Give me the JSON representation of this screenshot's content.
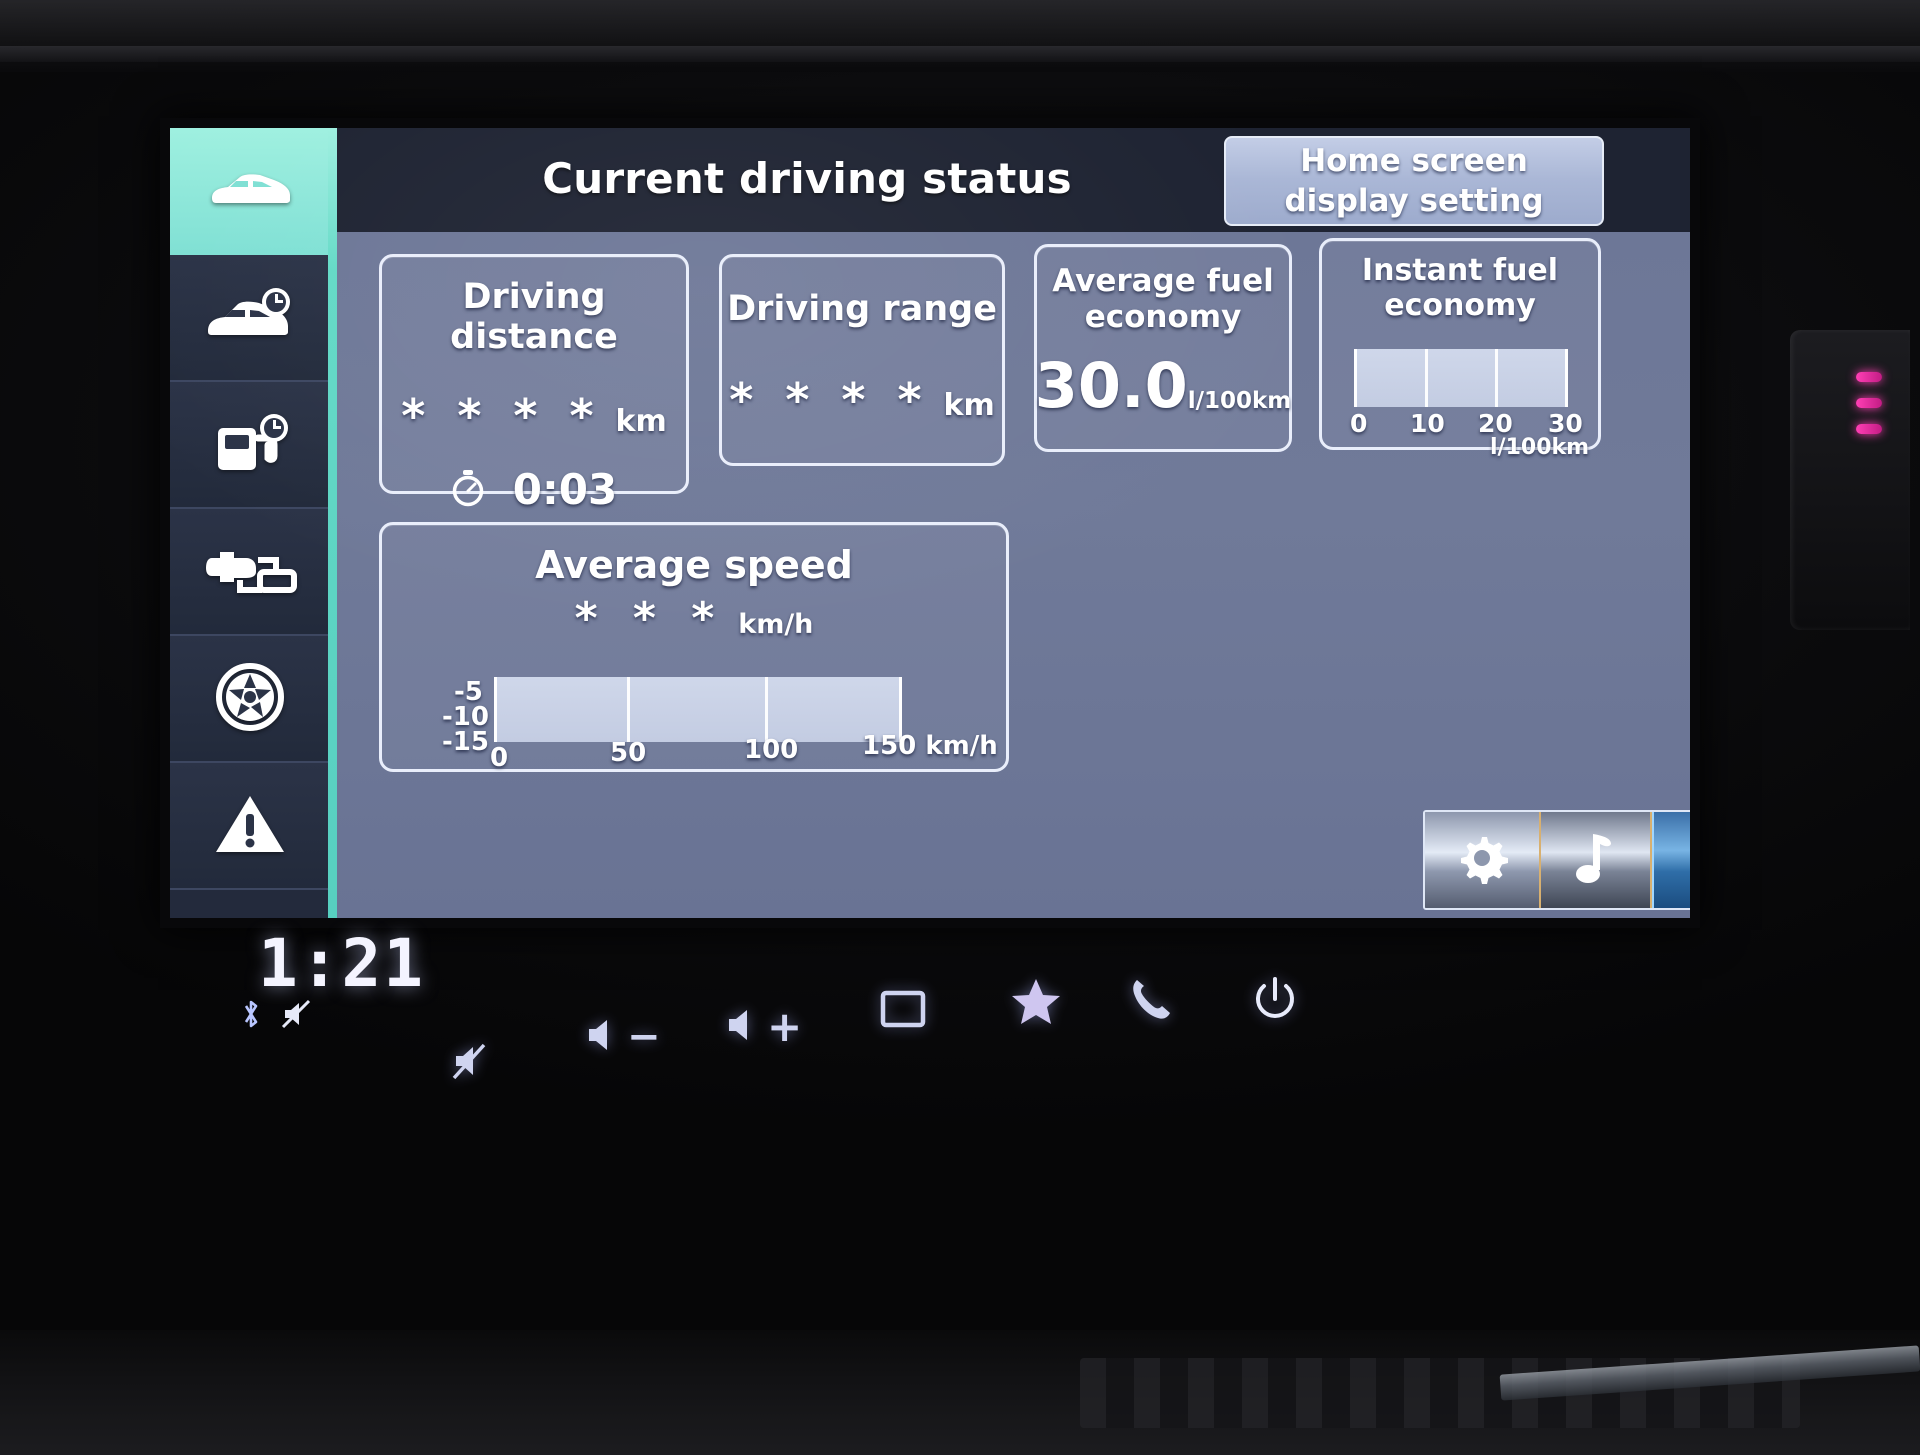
{
  "screen": {
    "header": {
      "title": "Current driving status",
      "home_button": {
        "line1": "Home screen",
        "line2": "display setting"
      }
    },
    "sidebar": [
      {
        "name": "vehicle-status",
        "icon": "car-icon",
        "active": true
      },
      {
        "name": "driving-time",
        "icon": "car-clock-icon",
        "active": false
      },
      {
        "name": "fuel-time",
        "icon": "fuel-pump-clock-icon",
        "active": false
      },
      {
        "name": "engine-system",
        "icon": "engine-network-icon",
        "active": false
      },
      {
        "name": "tyre-pressure",
        "icon": "wheel-icon",
        "active": false
      },
      {
        "name": "warnings",
        "icon": "warning-triangle-icon",
        "active": false
      }
    ],
    "cards": {
      "driving_distance": {
        "title_line1": "Driving",
        "title_line2": "distance",
        "value": "* * * *",
        "unit": "km",
        "timer_icon": "stopwatch-icon",
        "timer_value": "0:03"
      },
      "driving_range": {
        "title": "Driving range",
        "value": "* * * *",
        "unit": "km"
      },
      "average_fuel_economy": {
        "title_line1": "Average fuel",
        "title_line2": "economy",
        "value": "30.0",
        "unit": "l/100km"
      },
      "instant_fuel_economy": {
        "title_line1": "Instant fuel",
        "title_line2": "economy",
        "unit": "l/100km",
        "ticks": [
          "0",
          "10",
          "20",
          "30"
        ],
        "bar_fill_percent": 0
      },
      "average_speed": {
        "title": "Average speed",
        "value": "* * *",
        "unit": "km/h",
        "y_ticks": [
          "-5",
          "-10",
          "-15"
        ],
        "x_ticks": [
          "0",
          "50",
          "100"
        ],
        "x_last_tick": "150 km/h",
        "bar_fill_percent": 0
      }
    },
    "shortcut_bar": [
      {
        "name": "settings",
        "icon": "gear-icon",
        "selected": false
      },
      {
        "name": "media",
        "icon": "music-note-icon",
        "selected": false
      },
      {
        "name": "navigation",
        "icon": "navigation-arrow-icon",
        "selected": true
      }
    ]
  },
  "status_strip": {
    "clock": "1:21",
    "icons": [
      {
        "name": "bluetooth",
        "icon": "bluetooth-icon"
      },
      {
        "name": "mute",
        "icon": "speaker-mute-icon"
      }
    ]
  },
  "hardware_buttons": [
    {
      "name": "mute",
      "icon": "speaker-mute-icon",
      "label": ""
    },
    {
      "name": "volume-down",
      "icon": "speaker-icon",
      "label": "−"
    },
    {
      "name": "volume-up",
      "icon": "speaker-icon",
      "label": "+"
    },
    {
      "name": "display-off",
      "icon": "screen-square-icon",
      "label": ""
    },
    {
      "name": "favorites",
      "icon": "star-icon",
      "label": ""
    },
    {
      "name": "phone",
      "icon": "phone-handset-icon",
      "label": ""
    },
    {
      "name": "power",
      "icon": "power-icon",
      "label": ""
    }
  ],
  "colors": {
    "accent_teal": "#7fe0d4",
    "panel_blue": "#6d7797",
    "header_navy": "#1e2332",
    "nav_blue": "#3a6fa8",
    "led_magenta": "#ff3fb5"
  }
}
